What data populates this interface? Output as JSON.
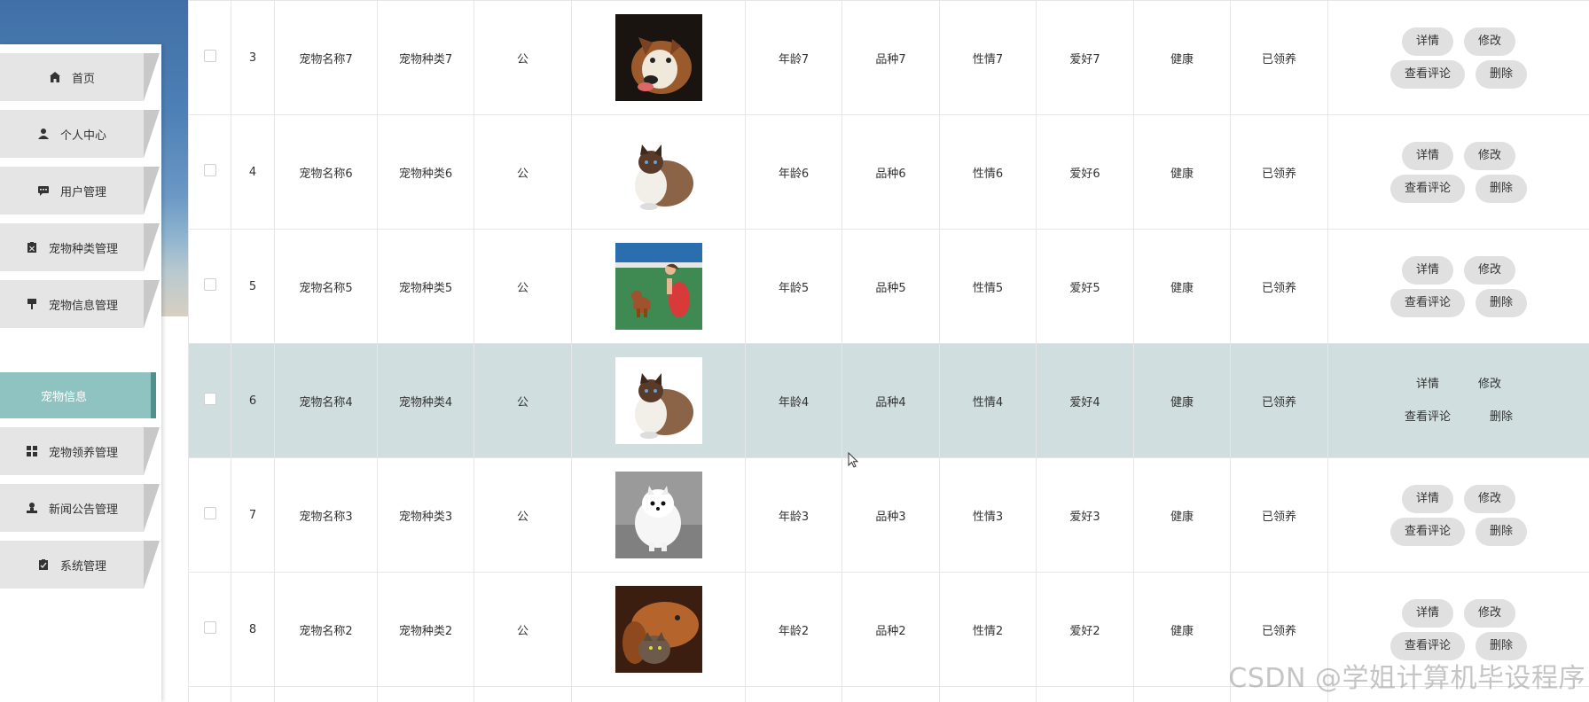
{
  "sidebar": {
    "items": [
      {
        "label": "首页",
        "icon": "home-icon"
      },
      {
        "label": "个人中心",
        "icon": "user-icon"
      },
      {
        "label": "用户管理",
        "icon": "chat-icon"
      },
      {
        "label": "宠物种类管理",
        "icon": "clipboard-icon"
      },
      {
        "label": "宠物信息管理",
        "icon": "pin-icon"
      },
      {
        "label": "宠物领养管理",
        "icon": "grid-icon"
      },
      {
        "label": "新闻公告管理",
        "icon": "person-icon"
      },
      {
        "label": "系统管理",
        "icon": "checklist-icon"
      }
    ],
    "active_sub": "宠物信息"
  },
  "actions": {
    "detail": "详情",
    "edit": "修改",
    "comments": "查看评论",
    "delete": "删除"
  },
  "rows": [
    {
      "index": "3",
      "name": "宠物名称7",
      "type": "宠物种类7",
      "gender": "公",
      "age": "年龄7",
      "breed": "品种7",
      "temper": "性情7",
      "hobby": "爱好7",
      "health": "健康",
      "status": "已领养",
      "image": "husky-dog"
    },
    {
      "index": "4",
      "name": "宠物名称6",
      "type": "宠物种类6",
      "gender": "公",
      "age": "年龄6",
      "breed": "品种6",
      "temper": "性情6",
      "hobby": "爱好6",
      "health": "健康",
      "status": "已领养",
      "image": "ragdoll-cat"
    },
    {
      "index": "5",
      "name": "宠物名称5",
      "type": "宠物种类5",
      "gender": "公",
      "age": "年龄5",
      "breed": "品种5",
      "temper": "性情5",
      "hobby": "爱好5",
      "health": "健康",
      "status": "已领养",
      "image": "girl-with-poodle"
    },
    {
      "index": "6",
      "name": "宠物名称4",
      "type": "宠物种类4",
      "gender": "公",
      "age": "年龄4",
      "breed": "品种4",
      "temper": "性情4",
      "hobby": "爱好4",
      "health": "健康",
      "status": "已领养",
      "image": "ragdoll-cat"
    },
    {
      "index": "7",
      "name": "宠物名称3",
      "type": "宠物种类3",
      "gender": "公",
      "age": "年龄3",
      "breed": "品种3",
      "temper": "性情3",
      "hobby": "爱好3",
      "health": "健康",
      "status": "已领养",
      "image": "pomeranian"
    },
    {
      "index": "8",
      "name": "宠物名称2",
      "type": "宠物种类2",
      "gender": "公",
      "age": "年龄2",
      "breed": "品种2",
      "temper": "性情2",
      "hobby": "爱好2",
      "health": "健康",
      "status": "已领养",
      "image": "bloodhound-with-cat"
    }
  ],
  "highlight_index": "6",
  "watermark": "CSDN @学姐计算机毕设程序",
  "colors": {
    "sidebar_button": "#e5e5e5",
    "active_sub": "#8fc3c1",
    "row_highlight": "#d0dedf",
    "action_button": "#e0e0e0"
  }
}
